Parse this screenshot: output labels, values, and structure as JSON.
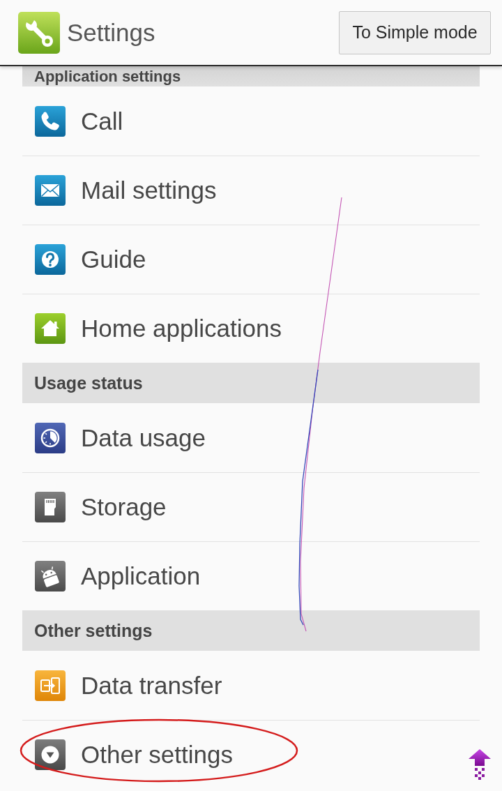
{
  "header": {
    "title": "Settings",
    "mode_button": "To Simple mode"
  },
  "sections": [
    {
      "title": "Application settings",
      "items": [
        {
          "label": "Call",
          "circled": false
        },
        {
          "label": "Mail settings",
          "circled": false
        },
        {
          "label": "Guide",
          "circled": false
        },
        {
          "label": "Home applications",
          "circled": false
        }
      ]
    },
    {
      "title": "Usage status",
      "items": [
        {
          "label": "Data usage",
          "circled": false
        },
        {
          "label": "Storage",
          "circled": false
        },
        {
          "label": "Application",
          "circled": false
        }
      ]
    },
    {
      "title": "Other settings",
      "items": [
        {
          "label": "Data transfer",
          "circled": false
        },
        {
          "label": "Other settings",
          "circled": true
        }
      ]
    }
  ]
}
